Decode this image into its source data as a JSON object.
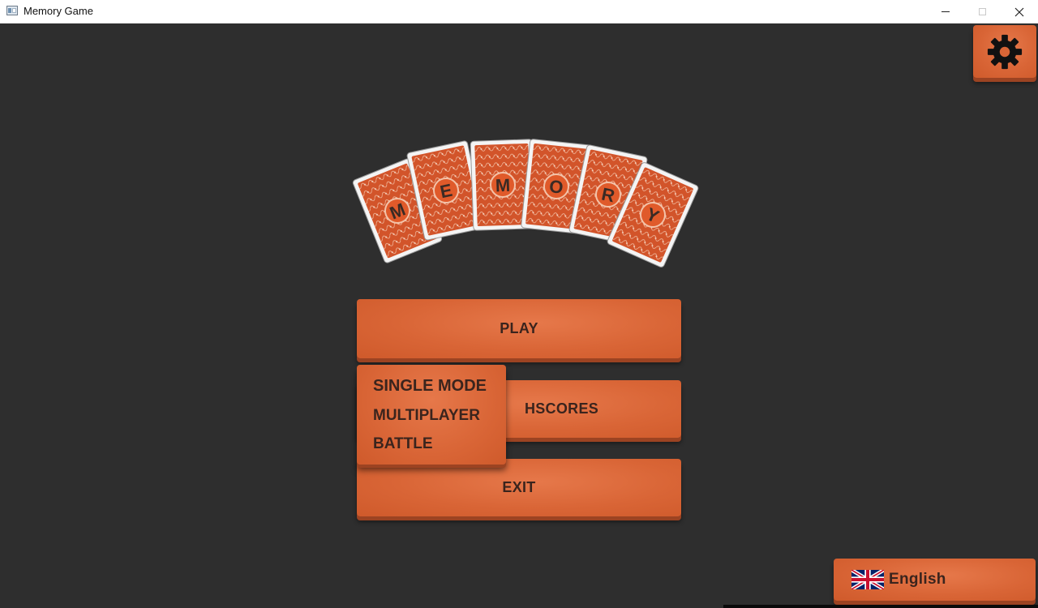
{
  "window": {
    "title": "Memory Game",
    "controls": [
      "minimize",
      "maximize",
      "close"
    ]
  },
  "settings": {
    "icon": "gear-icon"
  },
  "logo": {
    "letters": [
      "M",
      "E",
      "M",
      "O",
      "R",
      "Y"
    ]
  },
  "menu": {
    "play_label": "PLAY",
    "highscores_label": "HSCORES",
    "exit_label": "EXIT"
  },
  "play_dropdown": {
    "items": [
      "SINGLE MODE",
      "MULTIPLAYER",
      "BATTLE"
    ]
  },
  "language": {
    "label": "English",
    "flag_icon": "uk-flag-icon"
  },
  "colors": {
    "background": "#2e2e2e",
    "button_orange": "#d96536",
    "button_shadow": "#9c4322",
    "button_text": "#3a241d",
    "card_red": "#d2542a"
  }
}
